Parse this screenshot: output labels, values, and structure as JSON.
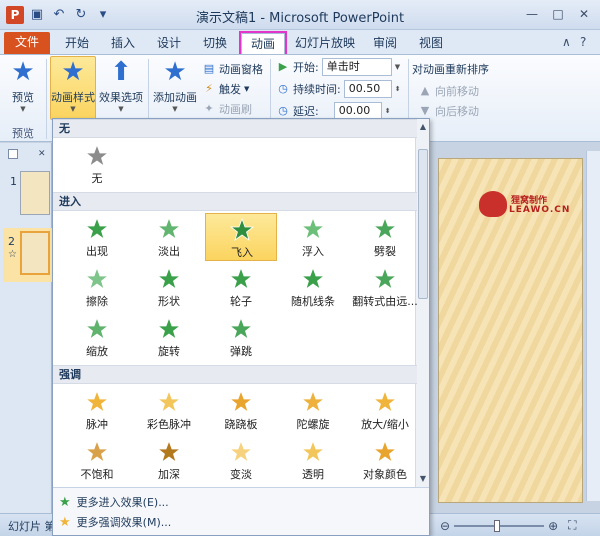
{
  "window": {
    "title": "演示文稿1 - Microsoft PowerPoint",
    "app_icon": "P",
    "qat_icons": [
      "save-icon",
      "undo-icon",
      "redo-icon"
    ],
    "controls": [
      "—",
      "□",
      "✕"
    ]
  },
  "tabs": {
    "file": "文件",
    "items": [
      "开始",
      "插入",
      "设计",
      "切换",
      "动画",
      "幻灯片放映",
      "审阅",
      "视图"
    ],
    "active": "动画"
  },
  "ribbon": {
    "preview": {
      "label": "预览",
      "group": "预览"
    },
    "animation_styles": "动画样式",
    "effect_options": "效果选项",
    "add_animation": "添加动画",
    "animation_pane": "动画窗格",
    "trigger": "触发",
    "animation_painter": "动画刷",
    "start_label": "开始:",
    "start_value": "单击时",
    "duration_label": "持续时间:",
    "duration_value": "00.50",
    "delay_label": "延迟:",
    "delay_value": "00.00",
    "reorder_title": "对动画重新排序",
    "move_earlier": "向前移动",
    "move_later": "向后移动"
  },
  "slides": [
    {
      "num": "1"
    },
    {
      "num": "2",
      "active": true,
      "mark": "☆"
    }
  ],
  "slide_logo": {
    "line1": "狸窝制作",
    "line2": "LEAWO.CN"
  },
  "status": {
    "left": "幻灯片 第"
  },
  "gallery": {
    "sections": [
      {
        "title": "无",
        "effects": [
          {
            "name": "无",
            "color": "#8c8c8c"
          }
        ]
      },
      {
        "title": "进入",
        "effects": [
          {
            "name": "出现",
            "color": "#3aa04a"
          },
          {
            "name": "淡出",
            "color": "#62b56f"
          },
          {
            "name": "飞入",
            "color": "#2f8f3e",
            "selected": true
          },
          {
            "name": "浮入",
            "color": "#6cbf78"
          },
          {
            "name": "劈裂",
            "color": "#4aa65a"
          },
          {
            "name": "擦除",
            "color": "#7fc48a"
          },
          {
            "name": "形状",
            "color": "#3aa04a"
          },
          {
            "name": "轮子",
            "color": "#3aa04a"
          },
          {
            "name": "随机线条",
            "color": "#3aa04a"
          },
          {
            "name": "翻转式由远...",
            "color": "#4aa65a"
          },
          {
            "name": "缩放",
            "color": "#5fb36d"
          },
          {
            "name": "旋转",
            "color": "#3aa04a"
          },
          {
            "name": "弹跳",
            "color": "#4aa65a"
          }
        ]
      },
      {
        "title": "强调",
        "effects": [
          {
            "name": "脉冲",
            "color": "#f0b43a"
          },
          {
            "name": "彩色脉冲",
            "color": "#f3c65c"
          },
          {
            "name": "跷跷板",
            "color": "#e9a42e"
          },
          {
            "name": "陀螺旋",
            "color": "#eeb13b"
          },
          {
            "name": "放大/缩小",
            "color": "#f0b43a"
          },
          {
            "name": "不饱和",
            "color": "#d9a24a"
          },
          {
            "name": "加深",
            "color": "#b27a1d"
          },
          {
            "name": "变淡",
            "color": "#f6d27f"
          },
          {
            "name": "透明",
            "color": "#f3c65c"
          },
          {
            "name": "对象颜色",
            "color": "#e9a42e"
          }
        ]
      }
    ],
    "more": [
      {
        "label": "更多进入效果(E)...",
        "color": "#3aa04a"
      },
      {
        "label": "更多强调效果(M)...",
        "color": "#f0b43a"
      }
    ]
  },
  "colors": {
    "file_tab": "#d8521f",
    "active_tab_outline": "#e335c9",
    "selected_bg": "#fbd45f"
  }
}
